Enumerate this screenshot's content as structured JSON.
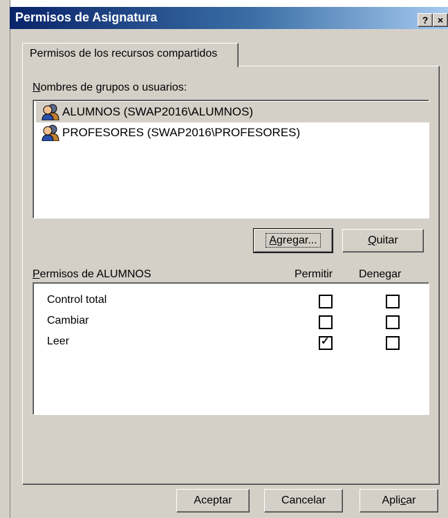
{
  "window": {
    "title": "Permisos de Asignatura",
    "help_glyph": "?",
    "close_glyph": "×"
  },
  "tab": {
    "label": "Permisos de los recursos compartidos"
  },
  "groups": {
    "label_prefix_u": "N",
    "label_rest": "ombres de grupos o usuarios:",
    "items": [
      {
        "label": "ALUMNOS (SWAP2016\\ALUMNOS)",
        "icon": "user-group-icon",
        "selected": true
      },
      {
        "label": "PROFESORES (SWAP2016\\PROFESORES)",
        "icon": "user-group-icon",
        "selected": false
      }
    ],
    "add_prefix_u": "A",
    "add_rest": "gregar...",
    "remove_prefix_u": "Q",
    "remove_rest": "uitar"
  },
  "permissions": {
    "label_prefix_u": "P",
    "label_rest": "ermisos de ALUMNOS",
    "col_allow": "Permitir",
    "col_deny": "Denegar",
    "rows": [
      {
        "name": "Control total",
        "allow": false,
        "deny": false
      },
      {
        "name": "Cambiar",
        "allow": false,
        "deny": false
      },
      {
        "name": "Leer",
        "allow": true,
        "deny": false
      }
    ]
  },
  "footer": {
    "ok": "Aceptar",
    "cancel": "Cancelar",
    "apply_prefix": "Apli",
    "apply_u": "c",
    "apply_rest": "ar"
  },
  "colors": {
    "titlebar_start": "#0a246a",
    "titlebar_end": "#a6caf0",
    "face": "#d4d0c8"
  }
}
